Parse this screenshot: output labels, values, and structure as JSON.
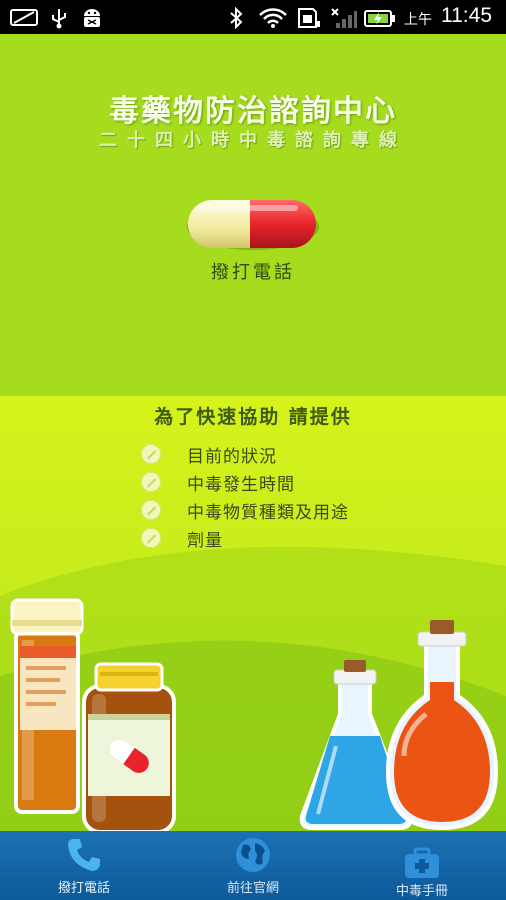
{
  "status_bar": {
    "ampm": "上午",
    "time": "11:45",
    "icons": [
      "screen-icon",
      "usb-icon",
      "android-debug-icon",
      "bluetooth-icon",
      "wifi-icon",
      "sd-card-icon",
      "signal-icon",
      "battery-charging-icon"
    ]
  },
  "header": {
    "title": "毒藥物防治諮詢中心",
    "subtitle": "二十四小時中毒諮詢專線"
  },
  "call_button": {
    "label": "撥打電話",
    "icon": "capsule-pill-icon",
    "colors": {
      "left": "#f5f0a8",
      "right": "#e8242a"
    }
  },
  "info": {
    "heading": "為了快速協助 請提供",
    "items": [
      "目前的狀況",
      "中毒發生時間",
      "中毒物質種類及用途",
      "劑量"
    ]
  },
  "illustration": {
    "items": [
      "medicine-bottle-orange",
      "medicine-bottle-brown",
      "flask-blue",
      "flask-red"
    ]
  },
  "nav": {
    "items": [
      {
        "label": "撥打電話",
        "icon": "phone-icon"
      },
      {
        "label": "前往官網",
        "icon": "globe-icon"
      },
      {
        "label": "中毒手冊",
        "icon": "first-aid-kit-icon"
      }
    ]
  },
  "colors": {
    "app_background": "#a6dc1e",
    "panel_background": "#d6f21a",
    "nav_background": "#1b72b4",
    "accent_red": "#e8242a"
  }
}
